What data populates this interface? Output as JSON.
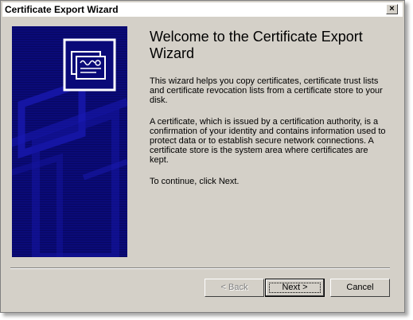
{
  "window": {
    "title": "Certificate Export Wizard",
    "close_symbol": "×"
  },
  "content": {
    "heading": "Welcome to the Certificate Export Wizard",
    "paragraph1": "This wizard helps you copy certificates, certificate trust lists and certificate revocation lists from a certificate store to your disk.",
    "paragraph2": "A certificate, which is issued by a certification authority, is a confirmation of your identity and contains information used to protect data or to establish secure network connections. A certificate store is the system area where certificates are kept.",
    "paragraph3": "To continue, click Next."
  },
  "buttons": {
    "back": "< Back",
    "next": "Next >",
    "cancel": "Cancel"
  },
  "icons": {
    "banner": "certificate-icon"
  },
  "colors": {
    "banner_bg": "#0a0a78",
    "face": "#d4d0c8"
  }
}
